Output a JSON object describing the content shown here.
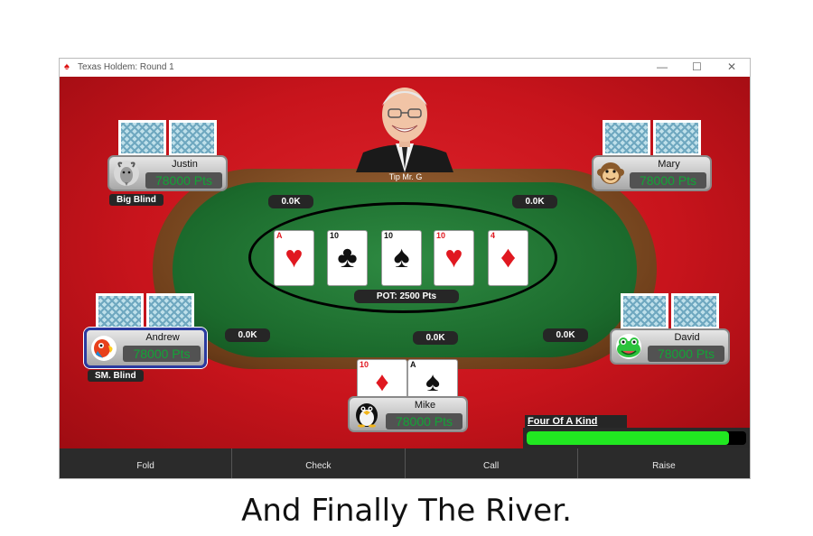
{
  "window": {
    "title": "Texas Holdem: Round 1",
    "controls": {
      "minimize": "—",
      "maximize": "☐",
      "close": "✕"
    }
  },
  "dealer": {
    "label": "Tip Mr. G"
  },
  "board": {
    "cards": [
      {
        "rank": "A",
        "suit": "♥",
        "color": "red"
      },
      {
        "rank": "10",
        "suit": "♣",
        "color": "black"
      },
      {
        "rank": "10",
        "suit": "♠",
        "color": "black"
      },
      {
        "rank": "10",
        "suit": "♥",
        "color": "red"
      },
      {
        "rank": "4",
        "suit": "♦",
        "color": "red"
      }
    ],
    "pot": "POT: 2500 Pts"
  },
  "bets": {
    "justin": "0.0K",
    "mary": "0.0K",
    "andrew": "0.0K",
    "mike": "0.0K",
    "david": "0.0K"
  },
  "players": {
    "justin": {
      "name": "Justin",
      "points": "78000 Pts",
      "avatar": "goat-icon",
      "role": "Big Blind"
    },
    "mary": {
      "name": "Mary",
      "points": "78000 Pts",
      "avatar": "monkey-icon"
    },
    "andrew": {
      "name": "Andrew",
      "points": "78000 Pts",
      "avatar": "parrot-icon",
      "role": "SM. Blind"
    },
    "david": {
      "name": "David",
      "points": "78000 Pts",
      "avatar": "frog-icon"
    },
    "mike": {
      "name": "Mike",
      "points": "78000 Pts",
      "avatar": "penguin-icon",
      "hand": [
        {
          "rank": "10",
          "suit": "♦",
          "color": "red"
        },
        {
          "rank": "A",
          "suit": "♠",
          "color": "black"
        }
      ]
    }
  },
  "hand_strength": {
    "label": "Four Of A Kind",
    "level": 0.92,
    "color": "#21e821"
  },
  "actions": {
    "fold": "Fold",
    "check": "Check",
    "call": "Call",
    "raise": "Raise"
  },
  "caption": "And Finally The River."
}
